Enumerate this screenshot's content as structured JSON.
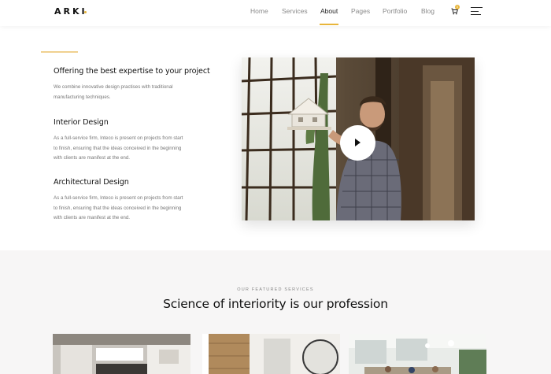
{
  "brand": {
    "logo": "ARKI"
  },
  "nav": {
    "items": [
      "Home",
      "Services",
      "About",
      "Pages",
      "Portfolio",
      "Blog"
    ],
    "active": "About",
    "cart_count": "0"
  },
  "features": [
    {
      "title": "Offering the best expertise to your project",
      "lines": [
        "We combine innovative design practises with traditional",
        "manufacturing techniques."
      ]
    },
    {
      "title": "Interior Design",
      "lines": [
        "As a full-service firm, Inteco is present on projects from start",
        "to finish, ensuring that the ideas conceived in the beginning",
        "with clients are manifest at the end."
      ]
    },
    {
      "title": "Architectural Design",
      "lines": [
        "As a full-service firm, Inteco is present on projects from start",
        "to finish, ensuring that the ideas conceived in the beginning",
        "with clients are manifest at the end."
      ]
    }
  ],
  "video": {
    "icon": "play-icon"
  },
  "featured": {
    "eyebrow": "OUR FEATURED SERVICES",
    "title": "Science of interiority is our profession"
  },
  "colors": {
    "accent": "#e8b53a",
    "section_bg": "#f7f6f6",
    "text_muted": "#777777"
  }
}
